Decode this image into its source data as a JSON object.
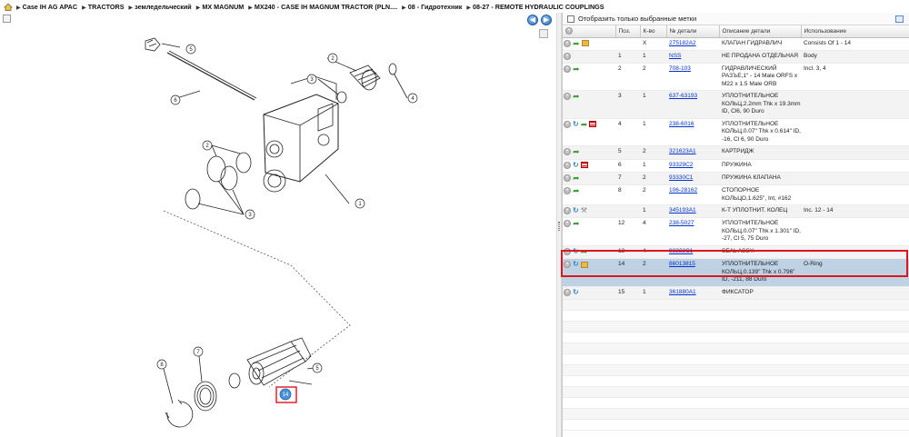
{
  "breadcrumb": {
    "home_icon": "home-icon",
    "items": [
      "Case IH AG APAC",
      "TRACTORS",
      "земледельческий",
      "MX MAGNUM",
      "MX240 - CASE IH MAGNUM TRACTOR (PLN....",
      "08 - Гидротехник",
      "08-27 - REMOTE HYDRAULIC COUPLINGS"
    ]
  },
  "diagram": {
    "callouts": [
      "5",
      "6",
      "2",
      "3",
      "4",
      "2",
      "3",
      "1",
      "5",
      "8",
      "7",
      "5"
    ],
    "highlight_label": "14"
  },
  "filter": {
    "label": "Отобразить только выбранные метки"
  },
  "table": {
    "headers": [
      "Поз.",
      "К-во",
      "№ детали",
      "Описание детали",
      "Использование"
    ],
    "rows": [
      {
        "pos": "",
        "qty": "X",
        "part": "275182A2",
        "desc": "КЛАПАН ГИДРАВЛИЧ",
        "usage": "Consists Of 1 - 14",
        "icons": [
          "plus",
          "arrow",
          "box"
        ]
      },
      {
        "pos": "1",
        "qty": "1",
        "part": "NSS",
        "desc": "НЕ ПРОДАНА ОТДЕЛЬНАЯ",
        "usage": "Body",
        "icons": [
          "plus"
        ]
      },
      {
        "pos": "2",
        "qty": "2",
        "part": "708-103",
        "desc": "ГИДРАВЛИЧЕСКИЙ РАЗЪЕ,1\" - 14 Male ORFS x M22 x 1.5 Male ORB",
        "usage": "Incl. 3, 4",
        "icons": [
          "plus",
          "arrow"
        ]
      },
      {
        "pos": "3",
        "qty": "1",
        "part": "637-63193",
        "desc": "УПЛОТНИТЕЛЬНОЕ КОЛЬЦ,2.2mm Thk x 19.3mm ID, Cl6, 90 Duro",
        "usage": "",
        "icons": [
          "plus",
          "arrow"
        ]
      },
      {
        "pos": "4",
        "qty": "1",
        "part": "238-6016",
        "desc": "УПЛОТНИТЕЛЬНОЕ КОЛЬЦ,0.07\" Thk x 0.614\" ID, -16, Cl 6, 90 Duro",
        "usage": "",
        "icons": [
          "plus",
          "cycle",
          "arrow",
          "flag"
        ]
      },
      {
        "pos": "5",
        "qty": "2",
        "part": "321623A1",
        "desc": "КАРТРИДЖ",
        "usage": "",
        "icons": [
          "plus",
          "arrow"
        ]
      },
      {
        "pos": "6",
        "qty": "1",
        "part": "93329C2",
        "desc": "ПРУЖИНА",
        "usage": "",
        "icons": [
          "plus",
          "cycle",
          "flag"
        ]
      },
      {
        "pos": "7",
        "qty": "2",
        "part": "93330C1",
        "desc": "ПРУЖИНА КЛАПАНА",
        "usage": "",
        "icons": [
          "plus",
          "arrow"
        ]
      },
      {
        "pos": "8",
        "qty": "2",
        "part": "106-28162",
        "desc": "СТОПОРНОЕ КОЛЬЦО,1.625\", Int, #162",
        "usage": "",
        "icons": [
          "plus",
          "arrow"
        ]
      },
      {
        "pos": "",
        "qty": "1",
        "part": "345193A1",
        "desc": "К-Т УПЛОТНИТ. КОЛЕЦ",
        "usage": "Inc. 12 - 14",
        "icons": [
          "plus",
          "cycle",
          "tool"
        ]
      },
      {
        "pos": "12",
        "qty": "4",
        "part": "238-5027",
        "desc": "УПЛОТНИТЕЛЬНОЕ КОЛЬЦ,0.07\" Thk x 1.301\" ID, -27, Cl 5, 75 Duro",
        "usage": "",
        "icons": [
          "plus",
          "arrow"
        ]
      },
      {
        "pos": "13",
        "qty": "4",
        "part": "93332C1",
        "desc": "SEAL ASSY.",
        "usage": "",
        "icons": [
          "plus",
          "cycle",
          "arrow"
        ]
      },
      {
        "pos": "14",
        "qty": "2",
        "part": "86013815",
        "desc": "УПЛОТНИТЕЛЬНОЕ КОЛЬЦ,0.139\" Thk x 0.796\" ID, -211, 88 Duro",
        "usage": "O-Ring",
        "icons": [
          "plus",
          "cycle",
          "box"
        ],
        "selected": true
      },
      {
        "pos": "15",
        "qty": "1",
        "part": "361880A1",
        "desc": "ФИКСАТОР",
        "usage": "",
        "icons": [
          "plus",
          "cycle"
        ]
      }
    ]
  },
  "colors": {
    "selection": "#bed2e3",
    "highlight_outline": "#e0141e",
    "link": "#0033cc"
  }
}
